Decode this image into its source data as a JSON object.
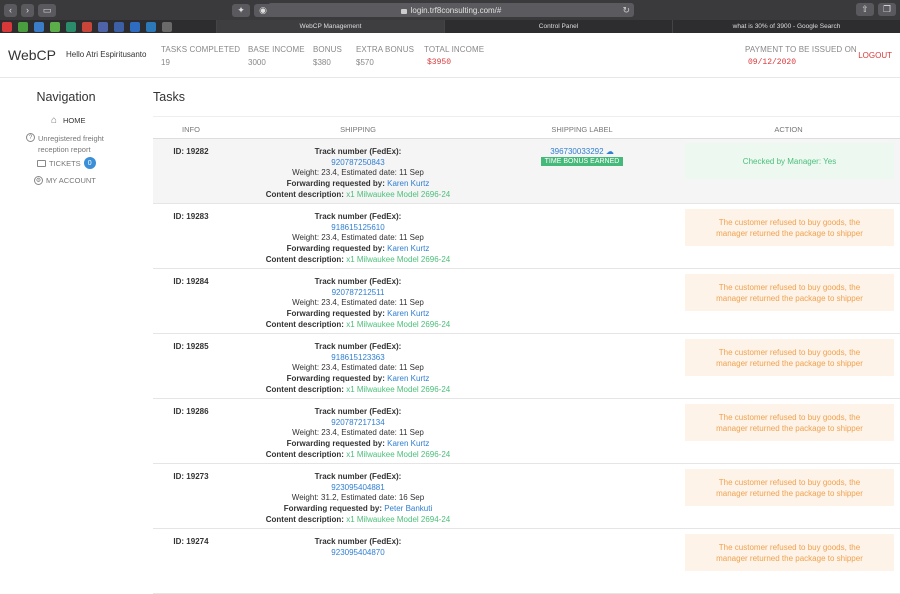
{
  "browser": {
    "url": "login.trf8consulting.com/#",
    "tabs": [
      "WebCP Management",
      "Control Panel",
      "what is 30% of 3900 - Google Search"
    ],
    "bookmark_colors": [
      "#d9383a",
      "#4a9d3f",
      "#3b7cc9",
      "#5cae4a",
      "#2a8c6a",
      "#c9453a",
      "#4f63a8",
      "#3c5fa6",
      "#2d6cc0",
      "#2b79b8",
      "#6a6a6a"
    ]
  },
  "header": {
    "logo": "WebCP",
    "greeting": "Hello Atri Espiritusanto",
    "stats": [
      {
        "label": "TASKS COMPLETED",
        "value": "19"
      },
      {
        "label": "BASE INCOME",
        "value": "3000"
      },
      {
        "label": "BONUS",
        "value": "$380"
      },
      {
        "label": "EXTRA BONUS",
        "value": "$570"
      },
      {
        "label": "TOTAL INCOME",
        "value": "$3950"
      }
    ],
    "payment": {
      "label": "PAYMENT TO BE ISSUED ON",
      "value": "09/12/2020"
    },
    "logout": "LOGOUT"
  },
  "sidebar": {
    "title": "Navigation",
    "home": "HOME",
    "unregistered_line1": "Unregistered freight",
    "unregistered_line2": "reception report",
    "tickets": "TICKETS",
    "tickets_count": "0",
    "account": "MY ACCOUNT"
  },
  "main": {
    "title": "Tasks",
    "columns": [
      "INFO",
      "SHIPPING",
      "SHIPPING LABEL",
      "ACTION"
    ],
    "track_label": "Track number (FedEx):",
    "forward_label": "Forwarding requested by:",
    "content_label": "Content description:",
    "rows": [
      {
        "id": "ID: 19282",
        "track": "920787250843",
        "weight": "Weight: 23.4, Estimated date: 11 Sep",
        "requester": "Karen Kurtz",
        "content": "x1 Milwaukee Model 2696-24",
        "label": "396730033292",
        "bonus": "TIME BONUS EARNED",
        "action": "Checked by Manager: Yes",
        "action_line2": ""
      },
      {
        "id": "ID: 19283",
        "track": "918615125610",
        "weight": "Weight: 23.4, Estimated date: 11 Sep",
        "requester": "Karen Kurtz",
        "content": "x1 Milwaukee Model 2696-24",
        "label": "",
        "bonus": "",
        "action": "The customer refused to buy goods, the",
        "action_line2": "manager returned the package to shipper"
      },
      {
        "id": "ID: 19284",
        "track": "920787212511",
        "weight": "Weight: 23.4, Estimated date: 11 Sep",
        "requester": "Karen Kurtz",
        "content": "x1 Milwaukee Model 2696-24",
        "label": "",
        "bonus": "",
        "action": "The customer refused to buy goods, the",
        "action_line2": "manager returned the package to shipper"
      },
      {
        "id": "ID: 19285",
        "track": "918615123363",
        "weight": "Weight: 23.4, Estimated date: 11 Sep",
        "requester": "Karen Kurtz",
        "content": "x1 Milwaukee Model 2696-24",
        "label": "",
        "bonus": "",
        "action": "The customer refused to buy goods, the",
        "action_line2": "manager returned the package to shipper"
      },
      {
        "id": "ID: 19286",
        "track": "920787217134",
        "weight": "Weight: 23.4, Estimated date: 11 Sep",
        "requester": "Karen Kurtz",
        "content": "x1 Milwaukee Model 2696-24",
        "label": "",
        "bonus": "",
        "action": "The customer refused to buy goods, the",
        "action_line2": "manager returned the package to shipper"
      },
      {
        "id": "ID: 19273",
        "track": "923095404881",
        "weight": "Weight: 31.2, Estimated date: 16 Sep",
        "requester": "Peter Bankuti",
        "content": "x1 Milwaukee Model 2694-24",
        "label": "",
        "bonus": "",
        "action": "The customer refused to buy goods, the",
        "action_line2": "manager returned the package to shipper"
      },
      {
        "id": "ID: 19274",
        "track": "923095404870",
        "weight": "",
        "requester": "",
        "content": "",
        "label": "",
        "bonus": "",
        "action": "The customer refused to buy goods, the",
        "action_line2": "manager returned the package to shipper"
      }
    ]
  }
}
